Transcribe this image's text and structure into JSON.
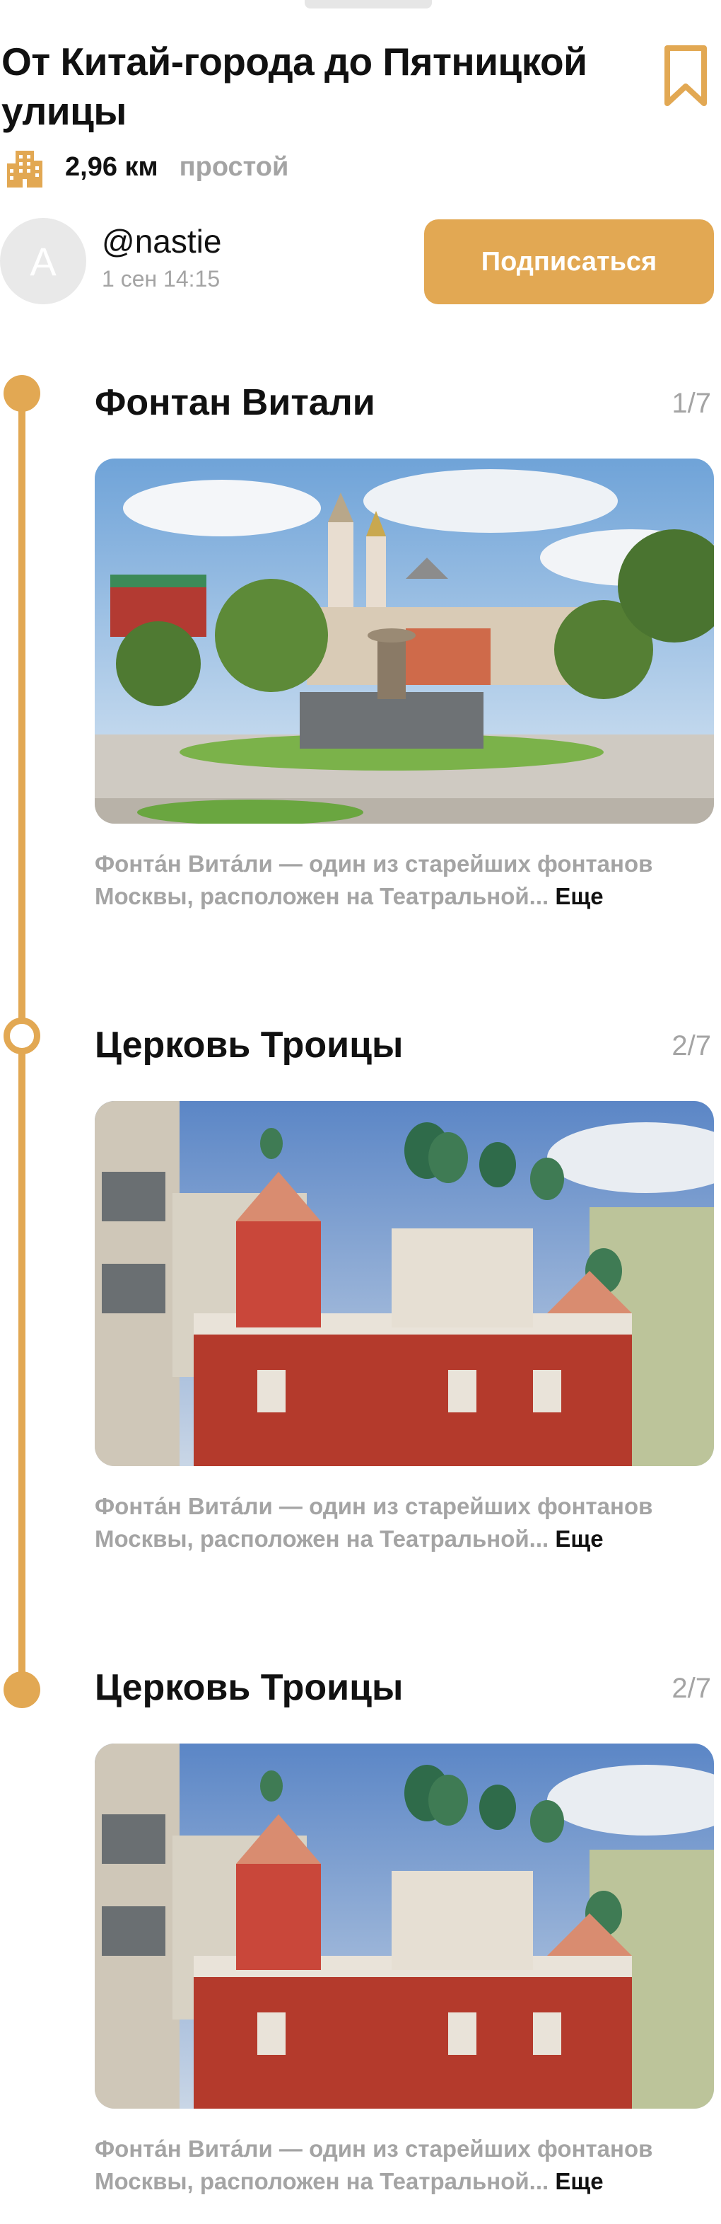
{
  "route": {
    "title": "От Китай-города до Пятницкой улицы",
    "distance": "2,96 км",
    "difficulty": "простой"
  },
  "author": {
    "initial": "A",
    "username": "@nastie",
    "date": "1 сен 14:15",
    "subscribe_label": "Подписаться"
  },
  "colors": {
    "accent": "#e2a853",
    "muted": "#a4a4a4"
  },
  "icons": [
    "city-icon",
    "bookmark-icon"
  ],
  "stops": [
    {
      "title": "Фонтан Витали",
      "counter": "1/7",
      "image": "fountain-photo",
      "description": "Фонта́н Вита́ли — один из старейших фонтанов Москвы,  расположен на Театральной...",
      "more_label": "Еще"
    },
    {
      "title": "Церковь Троицы",
      "counter": "2/7",
      "image": "church-photo",
      "description": "Фонта́н Вита́ли — один из старейших фонтанов Москвы,  расположен на Театральной...",
      "more_label": "Еще"
    },
    {
      "title": "Церковь Троицы",
      "counter": "2/7",
      "image": "church-photo",
      "description": "Фонта́н Вита́ли — один из старейших фонтанов Москвы,  расположен на Театральной...",
      "more_label": "Еще"
    }
  ]
}
